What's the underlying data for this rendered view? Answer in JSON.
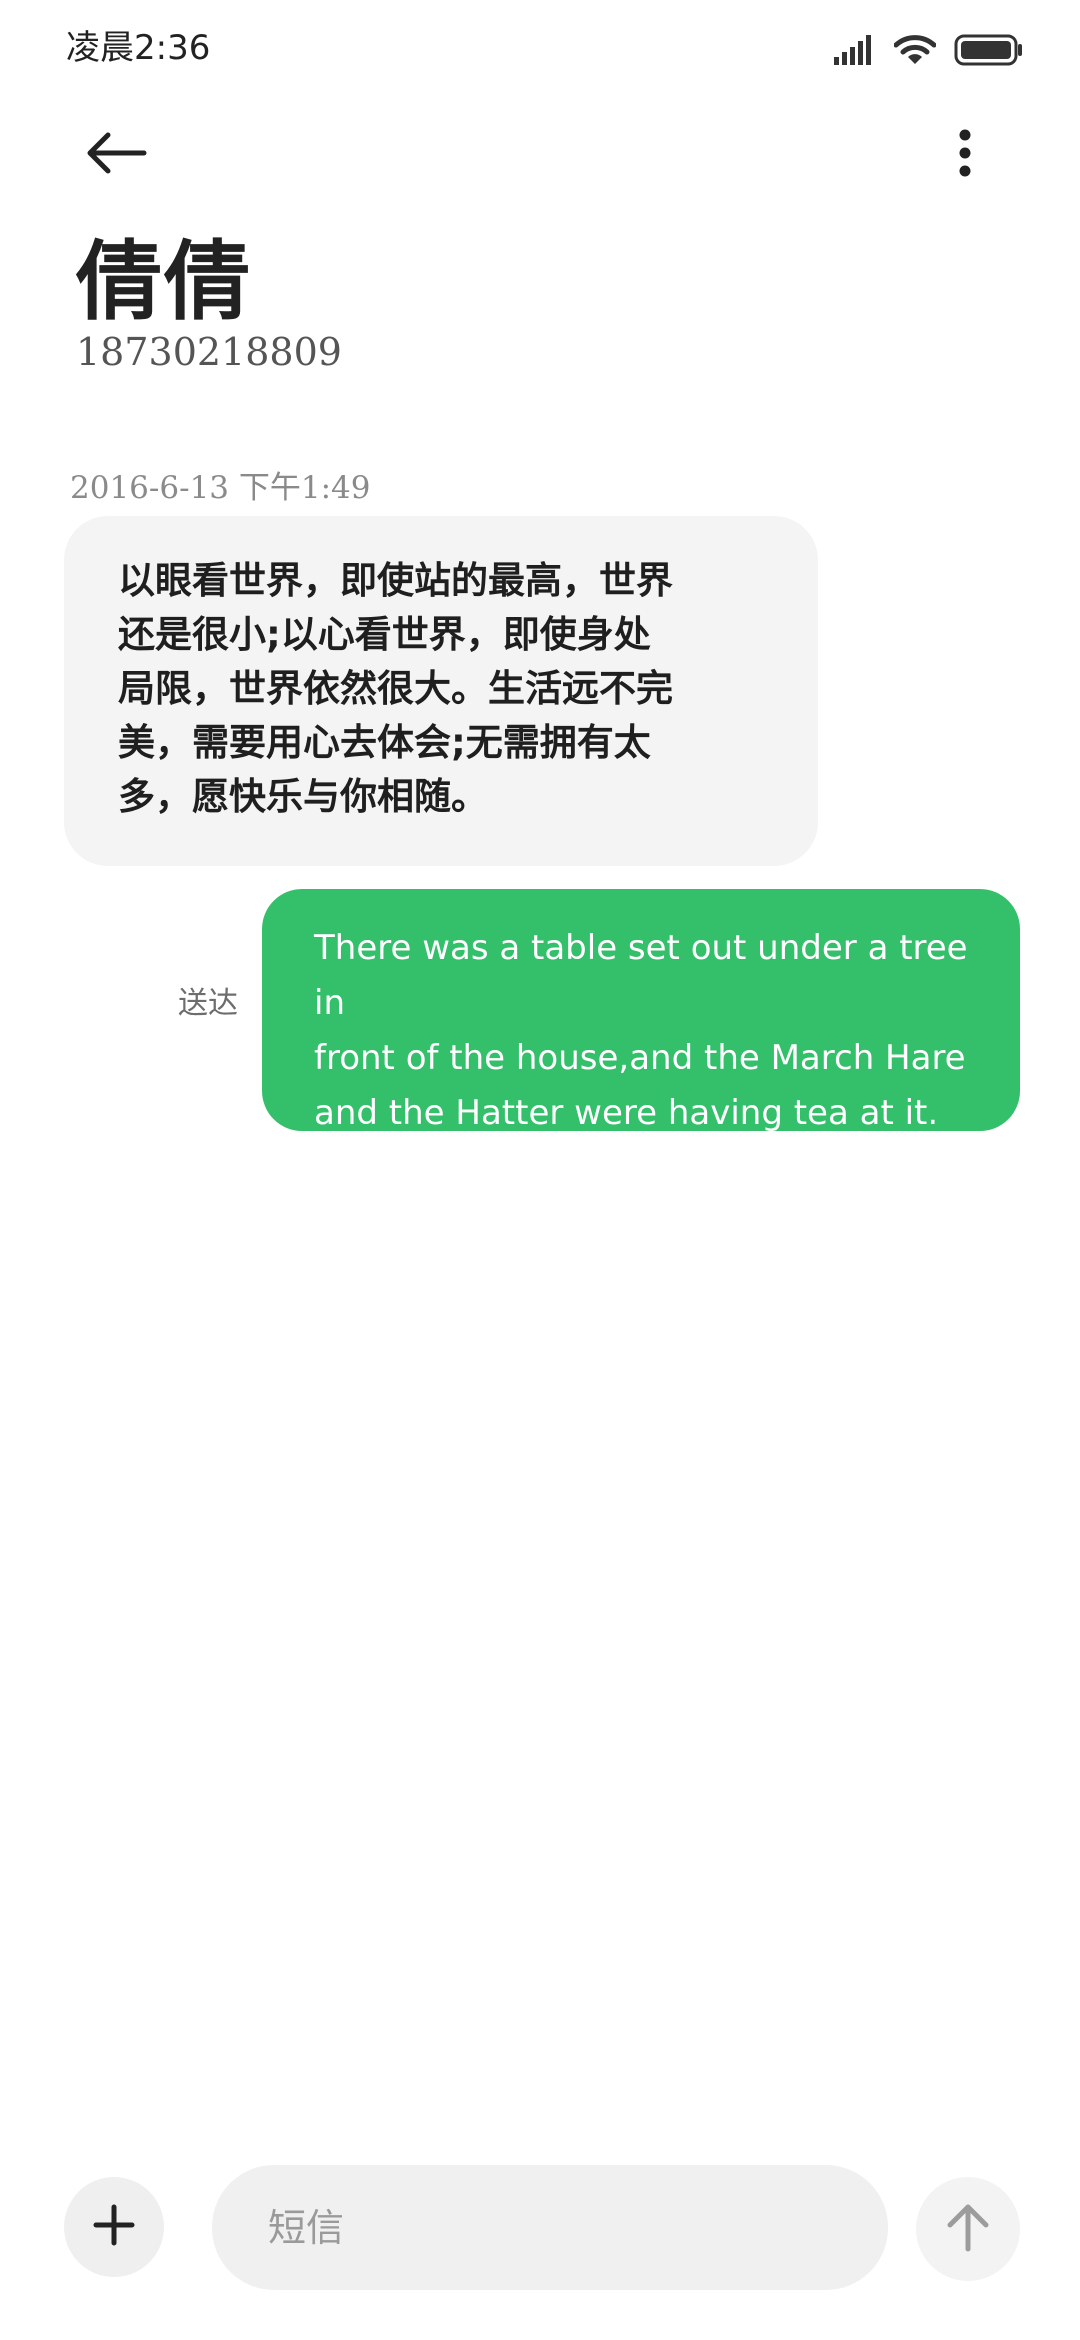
{
  "status_bar": {
    "time": "凌晨2:36",
    "icons": [
      "signal-icon",
      "wifi-icon",
      "battery-icon"
    ]
  },
  "header": {
    "back_icon": "back-arrow-icon",
    "menu_icon": "more-vertical-icon",
    "contact_name": "倩倩",
    "contact_number": "18730218809"
  },
  "conversation": {
    "timestamp": "2016-6-13 下午1:49",
    "incoming": {
      "lines": [
        "以眼看世界，即使站的最高，世界",
        "还是很小;以心看世界，即使身处",
        "局限，世界依然很大。生活远不完",
        "美，需要用心去体会;无需拥有太",
        "多，愿快乐与你相随。"
      ]
    },
    "outgoing": {
      "status": "送达",
      "lines": [
        "There was a table set out under a tree in",
        "front of the house,and the March Hare",
        "and the Hatter were having tea at it."
      ],
      "color": "#34c06b"
    }
  },
  "composer": {
    "add_icon": "plus-icon",
    "placeholder": "短信",
    "send_icon": "arrow-up-icon"
  }
}
